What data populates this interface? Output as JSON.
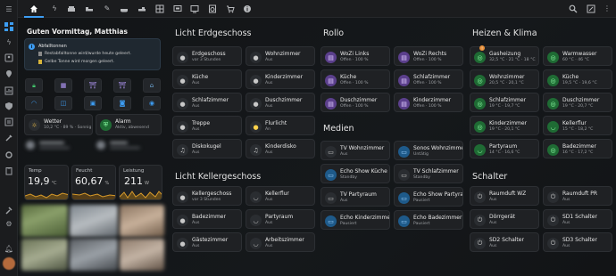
{
  "topbar": {
    "icons": [
      "home-icon",
      "flash-icon",
      "sofa-icon",
      "bed-icon",
      "pencil-icon",
      "bathtub-icon",
      "bed-icon",
      "grid-icon",
      "screen-icon",
      "display-icon",
      "washing-machine-icon",
      "cart-icon",
      "info-icon",
      "search-icon",
      "edit-icon",
      "more-icon"
    ]
  },
  "sidebar": {
    "icons": [
      "menu-icon",
      "dashboard-icon",
      "lightning-icon",
      "contact-icon",
      "map-icon",
      "chart-icon",
      "shield-icon",
      "list-icon",
      "tools-icon",
      "wrench-icon",
      "clipboard-icon",
      "hammer-icon",
      "gear-icon",
      "bell-icon",
      "avatar"
    ]
  },
  "home": {
    "greeting": "Guten Vormittag, Matthias",
    "waste": {
      "title": "Abfalltonnen",
      "line1": "Restabfalltonne wird/wurde heute geleert.",
      "line2": "Gelbe Tonne wird morgen geleert."
    },
    "weather": {
      "title": "Wetter",
      "sub": "10,2 °C · 89 % · Sonnig"
    },
    "alarm": {
      "title": "Alarm",
      "sub": "Aktiv, abwesend"
    },
    "temp": {
      "label": "Temp",
      "value": "19,9",
      "unit": "°C"
    },
    "humidity": {
      "label": "Feucht",
      "value": "60,67",
      "unit": "%"
    },
    "power": {
      "label": "Leistung",
      "value": "211",
      "unit": "W"
    }
  },
  "sections": {
    "licht_eg": "Licht Erdgeschoss",
    "licht_kg": "Licht Kellergeschoss",
    "rollo": "Rollo",
    "medien": "Medien",
    "heizen": "Heizen & Klima",
    "schalter": "Schalter"
  },
  "licht_eg": [
    {
      "name": "Erdgeschoss",
      "state": "vor 3 Stunden"
    },
    {
      "name": "Wohnzimmer",
      "state": "Aus"
    },
    {
      "name": "Küche",
      "state": "Aus"
    },
    {
      "name": "Kinderzimmer",
      "state": "Aus"
    },
    {
      "name": "Schlafzimmer",
      "state": "Aus"
    },
    {
      "name": "Duschzimmer",
      "state": "Aus"
    },
    {
      "name": "Treppe",
      "state": "Aus"
    },
    {
      "name": "Flurlicht",
      "state": "An"
    },
    {
      "name": "Diskokugel",
      "state": "Aus"
    },
    {
      "name": "Kinderdisko",
      "state": "Aus"
    }
  ],
  "licht_kg": [
    {
      "name": "Kellergeschoss",
      "state": "vor 3 Stunden"
    },
    {
      "name": "Kellerflur",
      "state": "Aus"
    },
    {
      "name": "Badezimmer",
      "state": "Aus"
    },
    {
      "name": "Partyraum",
      "state": "Aus"
    },
    {
      "name": "Gästezimmer",
      "state": "Aus"
    },
    {
      "name": "Arbeitszimmer",
      "state": "Aus"
    }
  ],
  "rollo": [
    {
      "name": "WoZi Links",
      "state": "Offen · 100 %"
    },
    {
      "name": "WoZi Rechts",
      "state": "Offen · 100 %"
    },
    {
      "name": "Küche",
      "state": "Offen · 100 %"
    },
    {
      "name": "Schlafzimmer",
      "state": "Offen · 100 %"
    },
    {
      "name": "Duschzimmer",
      "state": "Offen · 100 %"
    },
    {
      "name": "Kinderzimmer",
      "state": "Offen · 100 %"
    }
  ],
  "medien": [
    {
      "name": "TV Wohnzimmer",
      "state": "Aus"
    },
    {
      "name": "Sonos Wohnzimmer",
      "state": "Untätig"
    },
    {
      "name": "Echo Show Küche",
      "state": "Standby"
    },
    {
      "name": "TV Schlafzimmer",
      "state": "Standby"
    },
    {
      "name": "TV Partyraum",
      "state": "Aus"
    },
    {
      "name": "Echo Show Partyraum",
      "state": "Pausiert"
    },
    {
      "name": "Echo Kinderzimmer",
      "state": "Pausiert"
    },
    {
      "name": "Echo Badezimmer",
      "state": "Pausiert"
    }
  ],
  "heizen": [
    {
      "name": "Gasheizung",
      "state": "32,5 °C · 21 °C · 18 °C"
    },
    {
      "name": "Warmwasser",
      "state": "60 °C · 46 °C"
    },
    {
      "name": "Wohnzimmer",
      "state": "20,5 °C · 20,1 °C"
    },
    {
      "name": "Küche",
      "state": "19,5 °C · 19,6 °C"
    },
    {
      "name": "Schlafzimmer",
      "state": "19 °C · 19,7 °C"
    },
    {
      "name": "Duschzimmer",
      "state": "19 °C · 20,7 °C"
    },
    {
      "name": "Kinderzimmer",
      "state": "19 °C · 20,1 °C"
    },
    {
      "name": "Kellerflur",
      "state": "15 °C · 18,2 °C"
    },
    {
      "name": "Partyraum",
      "state": "14 °C · 16,6 °C"
    },
    {
      "name": "Badezimmer",
      "state": "16 °C · 17,2 °C"
    }
  ],
  "schalter": [
    {
      "name": "Raumduft WZ",
      "state": "Aus"
    },
    {
      "name": "Raumduft PR",
      "state": "Aus"
    },
    {
      "name": "Dörrgerät",
      "state": "Aus"
    },
    {
      "name": "SD1 Schalter",
      "state": "Aus"
    },
    {
      "name": "SD2 Schalter",
      "state": "Aus"
    },
    {
      "name": "SD3 Schalter",
      "state": "Aus"
    }
  ],
  "colors": {
    "accent": "#3d9df3",
    "purple": "#5b3f8c",
    "green": "#1f6b34",
    "alert": "#e8903a"
  }
}
